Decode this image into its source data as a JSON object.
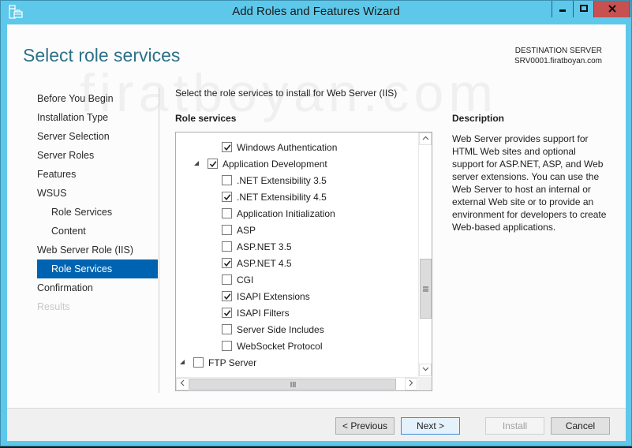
{
  "window": {
    "title": "Add Roles and Features Wizard",
    "controls": {
      "minimize": "minimize",
      "maximize": "maximize",
      "close": "close"
    }
  },
  "watermark": "firatboyan.com",
  "page_title": "Select role services",
  "destination": {
    "label": "DESTINATION SERVER",
    "server": "SRV0001.firatboyan.com"
  },
  "nav": {
    "items": [
      {
        "label": "Before You Begin",
        "level": 0,
        "state": "normal"
      },
      {
        "label": "Installation Type",
        "level": 0,
        "state": "normal"
      },
      {
        "label": "Server Selection",
        "level": 0,
        "state": "normal"
      },
      {
        "label": "Server Roles",
        "level": 0,
        "state": "normal"
      },
      {
        "label": "Features",
        "level": 0,
        "state": "normal"
      },
      {
        "label": "WSUS",
        "level": 0,
        "state": "normal"
      },
      {
        "label": "Role Services",
        "level": 1,
        "state": "normal"
      },
      {
        "label": "Content",
        "level": 1,
        "state": "normal"
      },
      {
        "label": "Web Server Role (IIS)",
        "level": 0,
        "state": "normal"
      },
      {
        "label": "Role Services",
        "level": 1,
        "state": "active"
      },
      {
        "label": "Confirmation",
        "level": 0,
        "state": "normal"
      },
      {
        "label": "Results",
        "level": 0,
        "state": "disabled"
      }
    ]
  },
  "main": {
    "instruction": "Select the role services to install for Web Server (IIS)",
    "role_services_label": "Role services",
    "tree": [
      {
        "label": "Windows Authentication",
        "level": 3,
        "checked": true,
        "expander": ""
      },
      {
        "label": "Application Development",
        "level": 2,
        "checked": true,
        "expander": "expanded"
      },
      {
        "label": ".NET Extensibility 3.5",
        "level": 3,
        "checked": false,
        "expander": ""
      },
      {
        "label": ".NET Extensibility 4.5",
        "level": 3,
        "checked": true,
        "expander": ""
      },
      {
        "label": "Application Initialization",
        "level": 3,
        "checked": false,
        "expander": ""
      },
      {
        "label": "ASP",
        "level": 3,
        "checked": false,
        "expander": ""
      },
      {
        "label": "ASP.NET 3.5",
        "level": 3,
        "checked": false,
        "expander": ""
      },
      {
        "label": "ASP.NET 4.5",
        "level": 3,
        "checked": true,
        "expander": ""
      },
      {
        "label": "CGI",
        "level": 3,
        "checked": false,
        "expander": ""
      },
      {
        "label": "ISAPI Extensions",
        "level": 3,
        "checked": true,
        "expander": ""
      },
      {
        "label": "ISAPI Filters",
        "level": 3,
        "checked": true,
        "expander": ""
      },
      {
        "label": "Server Side Includes",
        "level": 3,
        "checked": false,
        "expander": ""
      },
      {
        "label": "WebSocket Protocol",
        "level": 3,
        "checked": false,
        "expander": ""
      },
      {
        "label": "FTP Server",
        "level": 1,
        "checked": false,
        "expander": "expanded"
      }
    ]
  },
  "description": {
    "label": "Description",
    "text": "Web Server provides support for HTML Web sites and optional support for ASP.NET, ASP, and Web server extensions. You can use the Web Server to host an internal or external Web site or to provide an environment for developers to create Web-based applications."
  },
  "footer": {
    "previous": "< Previous",
    "next": "Next >",
    "install": "Install",
    "cancel": "Cancel"
  }
}
